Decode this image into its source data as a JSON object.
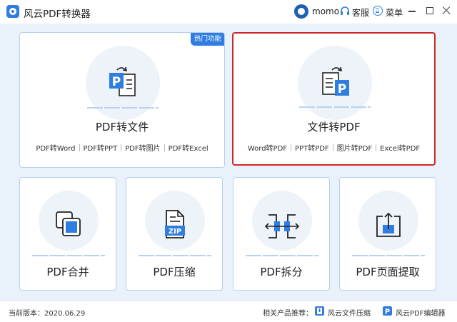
{
  "titlebar": {
    "app_title": "风云PDF转换器",
    "username": "momo",
    "service_label": "客服",
    "menu_label": "菜单"
  },
  "cards": {
    "pdf_to_file": {
      "title": "PDF转文件",
      "badge": "热门功能",
      "links": [
        "PDF转Word",
        "PDF转PPT",
        "PDF转图片",
        "PDF转Excel"
      ]
    },
    "file_to_pdf": {
      "title": "文件转PDF",
      "links": [
        "Word转PDF",
        "PPT转PDF",
        "图片转PDF",
        "Excel转PDF"
      ]
    },
    "merge": {
      "title": "PDF合并"
    },
    "compress": {
      "title": "PDF压缩",
      "icon_text": "ZIP"
    },
    "split": {
      "title": "PDF拆分"
    },
    "extract": {
      "title": "PDF页面提取"
    }
  },
  "statusbar": {
    "version": "当前版本：2020.06.29",
    "related_label": "相关产品推荐：",
    "products": [
      "风云文件压缩",
      "风云PDF编辑器"
    ]
  },
  "colors": {
    "accent": "#2f7de1",
    "selected_border": "#d0262a",
    "background": "#e9f1fb"
  }
}
